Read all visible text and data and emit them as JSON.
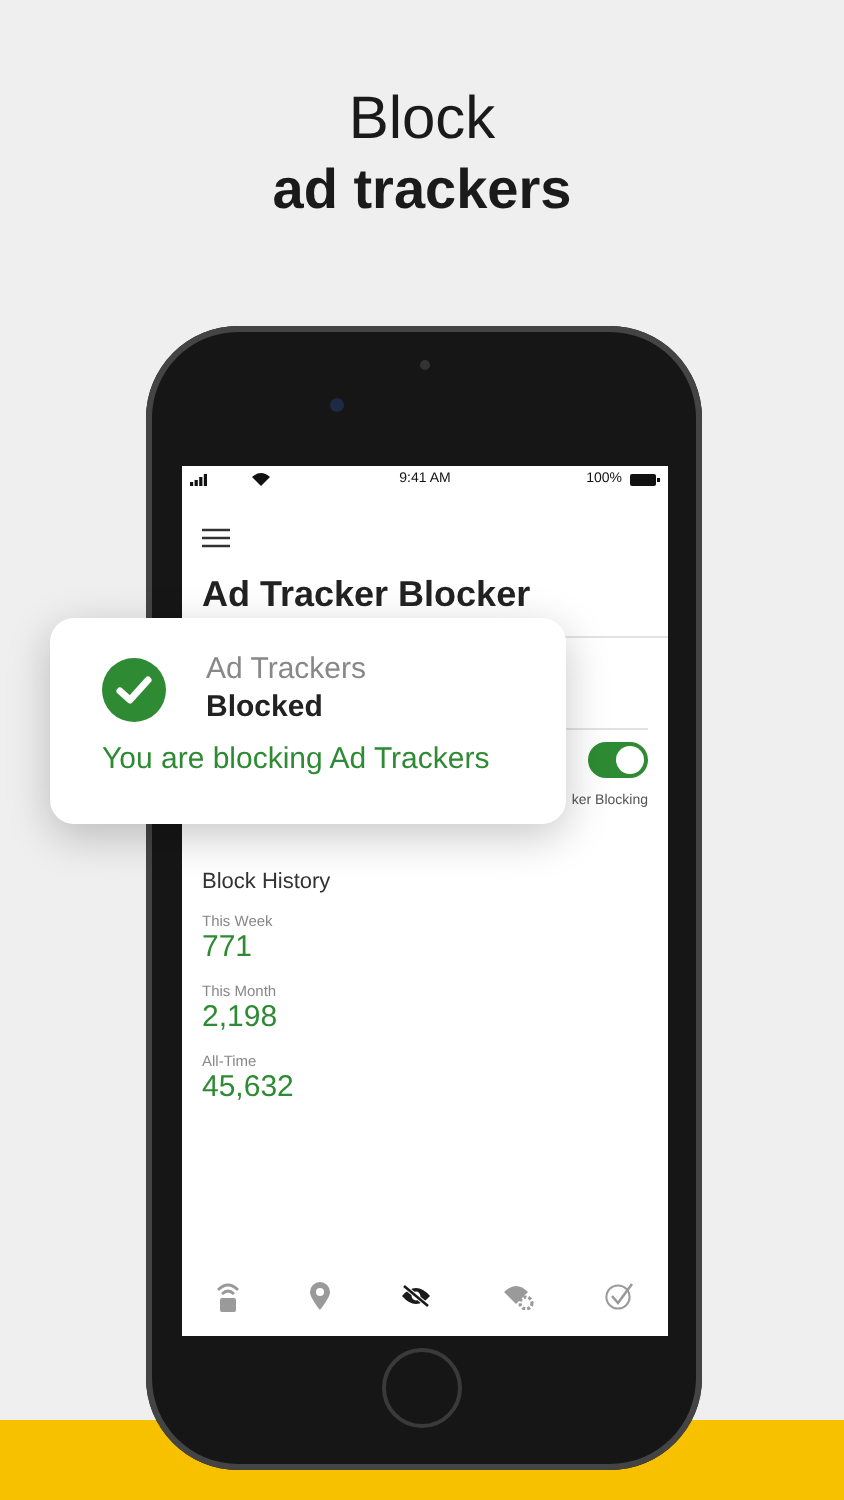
{
  "headline": {
    "light": "Block",
    "bold": "ad trackers"
  },
  "status_bar": {
    "time": "9:41 AM",
    "battery": "100%"
  },
  "screen": {
    "title": "Ad Tracker Blocker",
    "toggle": {
      "on": true
    },
    "note": "ker Blocking",
    "history_title": "Block History",
    "stats": [
      {
        "label": "This Week",
        "value": "771"
      },
      {
        "label": "This Month",
        "value": "2,198"
      },
      {
        "label": "All-Time",
        "value": "45,632"
      }
    ]
  },
  "tabs": [
    {
      "kind": "wifi-lock",
      "selected": false
    },
    {
      "kind": "pin",
      "selected": false
    },
    {
      "kind": "eye-off",
      "selected": true
    },
    {
      "kind": "wifi-gear",
      "selected": false
    },
    {
      "kind": "check",
      "selected": false
    }
  ],
  "toast": {
    "title": "Ad Trackers",
    "status": "Blocked",
    "message": "You are blocking Ad Trackers"
  }
}
